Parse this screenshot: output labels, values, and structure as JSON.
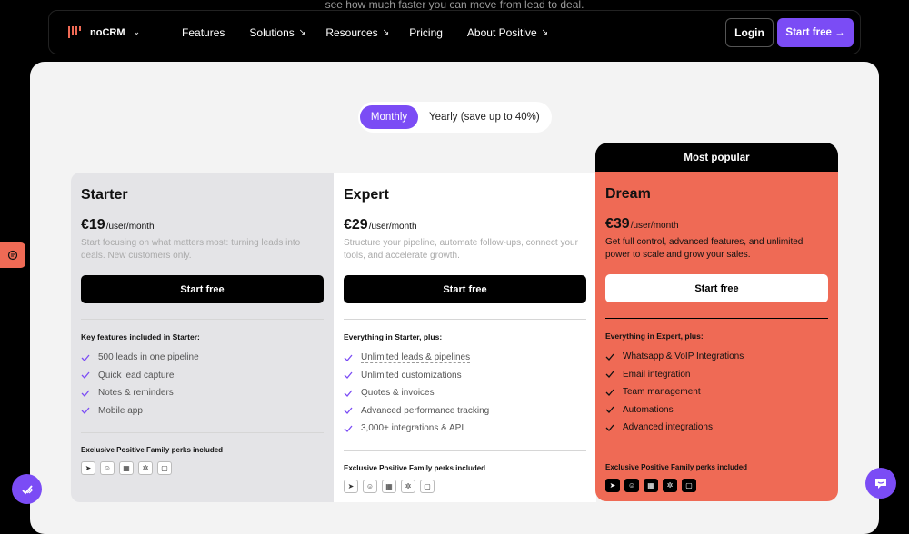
{
  "banner": {
    "text": "see how much faster you can move from lead to deal."
  },
  "nav": {
    "brand": "noCRM",
    "links": [
      {
        "label": "Features",
        "arrow": ""
      },
      {
        "label": "Solutions",
        "arrow": "↘"
      },
      {
        "label": "Resources",
        "arrow": "↘"
      },
      {
        "label": "Pricing",
        "arrow": ""
      },
      {
        "label": "About Positive",
        "arrow": "↘"
      }
    ],
    "login": "Login",
    "start": "Start free →"
  },
  "toggle": {
    "monthly": "Monthly",
    "yearly": "Yearly (save up to 40%)"
  },
  "plans": {
    "starter": {
      "name": "Starter",
      "price": "€19",
      "unit": "/user/month",
      "desc": "Start focusing on what matters most: turning leads into deals. New customers only.",
      "cta": "Start free",
      "features_title": "Key features included in Starter:",
      "features": [
        "500 leads in one pipeline",
        "Quick lead capture",
        "Notes & reminders",
        "Mobile app"
      ],
      "perks_title": "Exclusive Positive Family perks included"
    },
    "expert": {
      "name": "Expert",
      "price": "€29",
      "unit": "/user/month",
      "desc": "Structure your pipeline, automate follow-ups, connect your tools, and accelerate growth.",
      "cta": "Start free",
      "features_title": "Everything in Starter, plus:",
      "features": [
        "Unlimited leads & pipelines",
        "Unlimited customizations",
        "Quotes & invoices",
        "Advanced performance tracking",
        "3,000+ integrations & API"
      ],
      "perks_title": "Exclusive Positive Family perks included"
    },
    "dream": {
      "badge": "Most popular",
      "name": "Dream",
      "price": "€39",
      "unit": "/user/month",
      "desc": "Get full control, advanced features, and unlimited power to scale and grow your sales.",
      "cta": "Start free",
      "features_title": "Everything in Expert, plus:",
      "features": [
        "Whatsapp & VoIP Integrations",
        "Email integration",
        "Team management",
        "Automations",
        "Advanced integrations"
      ],
      "perks_title": "Exclusive Positive Family perks included"
    }
  },
  "perk_icons": [
    "send-icon",
    "chat-icon",
    "calendar-icon",
    "grid-icon",
    "message-icon"
  ],
  "colors": {
    "accent": "#7b4cf5",
    "dream": "#ef6a55"
  }
}
